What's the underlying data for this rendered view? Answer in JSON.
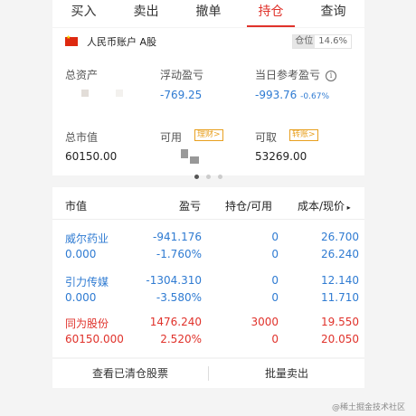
{
  "tabs": [
    {
      "label": "买入"
    },
    {
      "label": "卖出"
    },
    {
      "label": "撤单"
    },
    {
      "label": "持仓"
    },
    {
      "label": "查询"
    }
  ],
  "active_tab": "持仓",
  "account": {
    "name": "人民币账户 A股",
    "position_label": "仓位",
    "position_value": "14.6%"
  },
  "summary": {
    "total_assets_label": "总资产",
    "floating_pl_label": "浮动盈亏",
    "floating_pl_value": "-769.25",
    "daily_pl_label": "当日参考盈亏",
    "daily_pl_value": "-993.76",
    "daily_pl_pct": "-0.67%",
    "market_value_label": "总市值",
    "market_value": "60150.00",
    "available_label": "可用",
    "wealth_tag": "理财>",
    "withdrawable_label": "可取",
    "withdrawable_value": "53269.00",
    "transfer_tag": "转账>"
  },
  "table": {
    "headers": {
      "col1": "市值",
      "col2": "盈亏",
      "col3": "持仓/可用",
      "col4": "成本/现价"
    },
    "rows": [
      {
        "name": "威尔药业",
        "market_value": "0.000",
        "pl": "-941.176",
        "pl_pct": "-1.760%",
        "hold": "0",
        "avail": "0",
        "cost": "26.700",
        "price": "26.240",
        "color": "#2f7bd2"
      },
      {
        "name": "引力传媒",
        "market_value": "0.000",
        "pl": "-1304.310",
        "pl_pct": "-3.580%",
        "hold": "0",
        "avail": "0",
        "cost": "12.140",
        "price": "11.710",
        "color": "#2f7bd2"
      },
      {
        "name": "同为股份",
        "market_value": "60150.000",
        "pl": "1476.240",
        "pl_pct": "2.520%",
        "hold": "3000",
        "avail": "0",
        "cost": "19.550",
        "price": "20.050",
        "color": "#e0322b"
      }
    ]
  },
  "buttons": {
    "view_cleared": "查看已清仓股票",
    "batch_sell": "批量卖出"
  },
  "watermark": "@稀土掘金技术社区",
  "colors": {
    "accent": "#e0322b",
    "loss": "#2f7bd2",
    "gain": "#e0322b"
  }
}
